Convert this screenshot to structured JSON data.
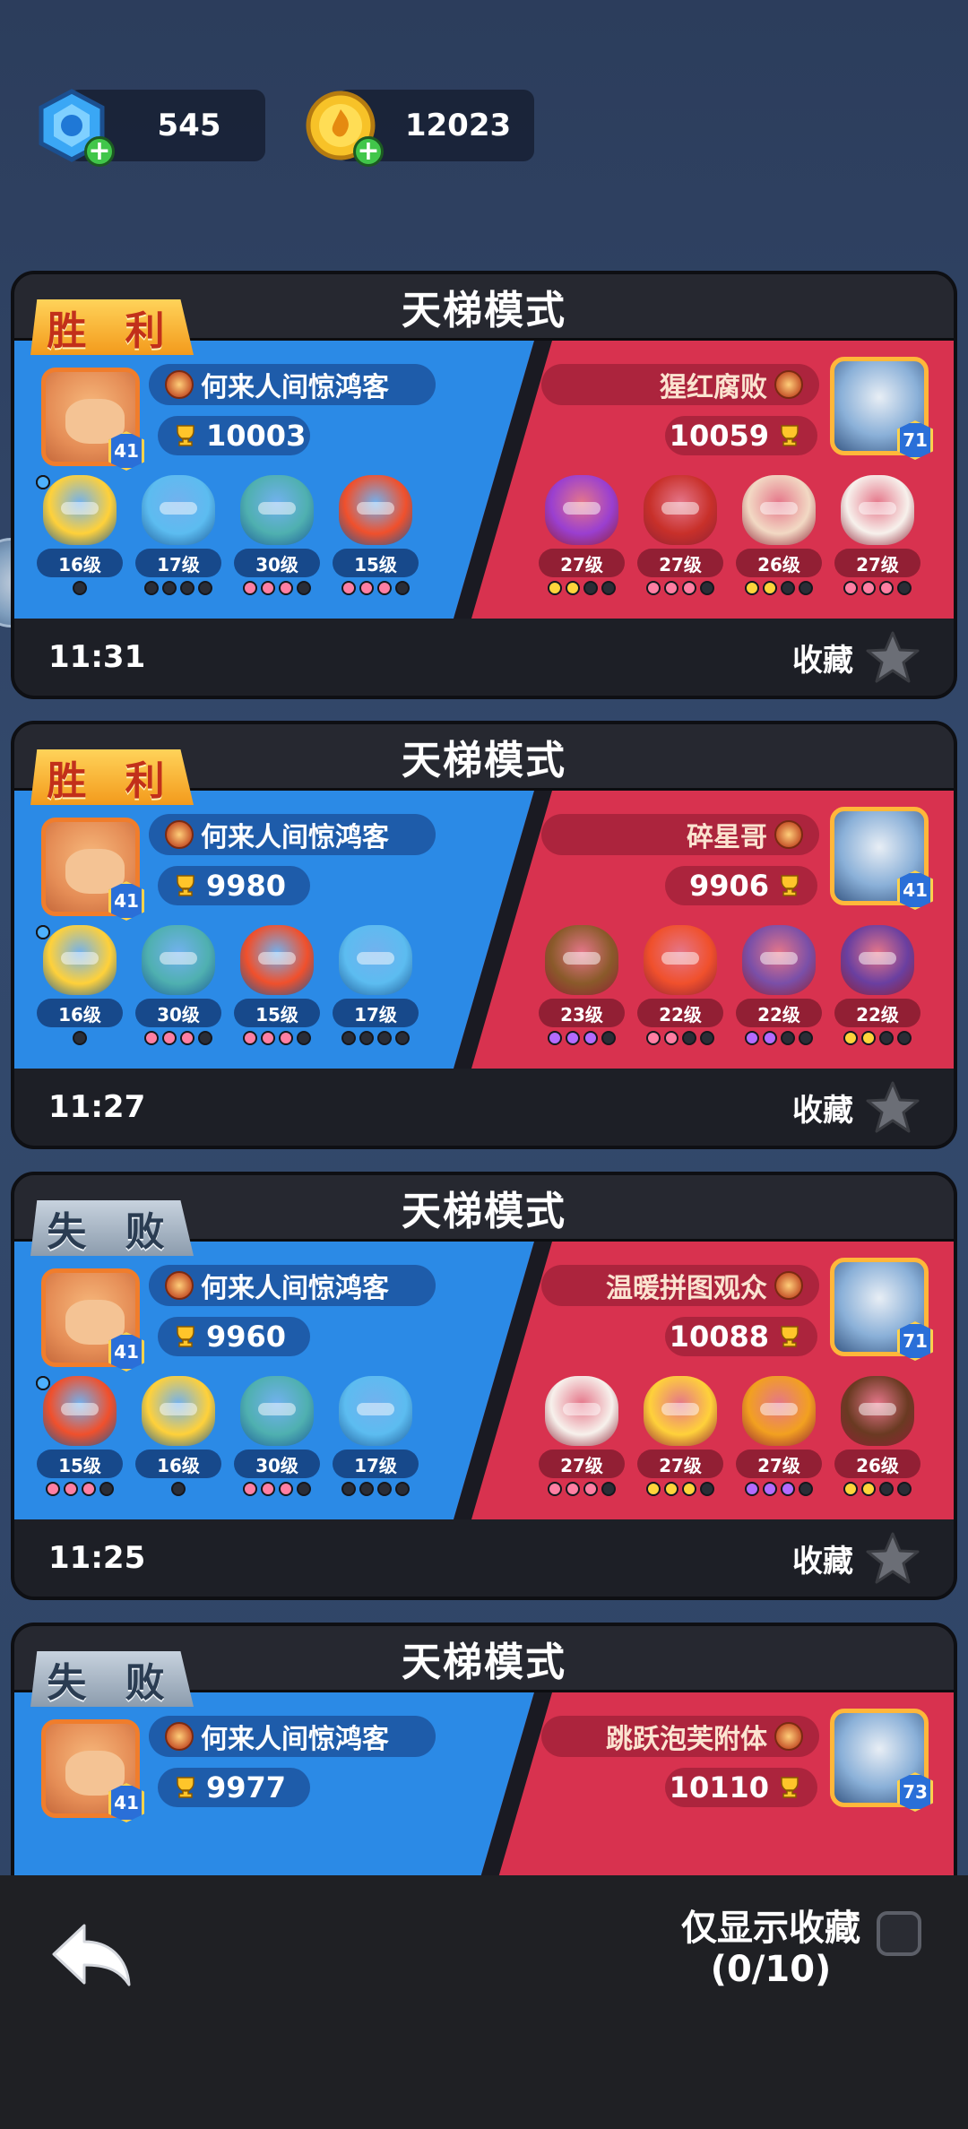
{
  "currency": {
    "gems": "545",
    "coins": "12023"
  },
  "cards": [
    {
      "mode": "天梯模式",
      "result": "胜 利",
      "result_type": "win",
      "time": "11:31",
      "fav_label": "收藏",
      "left_player": {
        "name": "何来人间惊鸿客",
        "trophies": "10003",
        "level": "41"
      },
      "right_player": {
        "name": "猩红腐败",
        "trophies": "10059",
        "level": "71"
      },
      "left_units": [
        {
          "lv": "16级",
          "dots": [
            "blue",
            "blue",
            "blue",
            "dark"
          ],
          "color": "#ffd13a"
        },
        {
          "lv": "17级",
          "dots": [
            "dark",
            "dark",
            "dark",
            "dark"
          ],
          "color": "#5cbcf0"
        },
        {
          "lv": "30级",
          "dots": [
            "pink",
            "pink",
            "pink",
            "dark"
          ],
          "color": "#4fb0b0"
        },
        {
          "lv": "15级",
          "dots": [
            "pink",
            "pink",
            "pink",
            "dark"
          ],
          "color": "#f0502c"
        }
      ],
      "right_units": [
        {
          "lv": "27级",
          "dots": [
            "yellow",
            "yellow",
            "dark",
            "dark"
          ],
          "color": "#9a3fd0"
        },
        {
          "lv": "27级",
          "dots": [
            "pink",
            "pink",
            "pink",
            "dark"
          ],
          "color": "#c8302a"
        },
        {
          "lv": "26级",
          "dots": [
            "yellow",
            "yellow",
            "dark",
            "dark"
          ],
          "color": "#f2d9c4"
        },
        {
          "lv": "27级",
          "dots": [
            "pink",
            "pink",
            "pink",
            "dark"
          ],
          "color": "#f7f1ec"
        }
      ]
    },
    {
      "mode": "天梯模式",
      "result": "胜 利",
      "result_type": "win",
      "time": "11:27",
      "fav_label": "收藏",
      "left_player": {
        "name": "何来人间惊鸿客",
        "trophies": "9980",
        "level": "41"
      },
      "right_player": {
        "name": "碎星哥",
        "trophies": "9906",
        "level": "41"
      },
      "left_units": [
        {
          "lv": "16级",
          "dots": [
            "blue",
            "blue",
            "blue",
            "dark"
          ],
          "color": "#ffd13a"
        },
        {
          "lv": "30级",
          "dots": [
            "pink",
            "pink",
            "pink",
            "dark"
          ],
          "color": "#4fb0b0"
        },
        {
          "lv": "15级",
          "dots": [
            "pink",
            "pink",
            "pink",
            "dark"
          ],
          "color": "#f0502c"
        },
        {
          "lv": "17级",
          "dots": [
            "dark",
            "dark",
            "dark",
            "dark"
          ],
          "color": "#5cbcf0"
        }
      ],
      "right_units": [
        {
          "lv": "23级",
          "dots": [
            "purple",
            "purple",
            "purple",
            "dark"
          ],
          "color": "#8a5a2a"
        },
        {
          "lv": "22级",
          "dots": [
            "pink",
            "pink",
            "dark",
            "dark"
          ],
          "color": "#f0502c"
        },
        {
          "lv": "22级",
          "dots": [
            "purple",
            "purple",
            "dark",
            "dark"
          ],
          "color": "#7a4fa8"
        },
        {
          "lv": "22级",
          "dots": [
            "yellow",
            "yellow",
            "dark",
            "dark"
          ],
          "color": "#6a3fa0"
        }
      ]
    },
    {
      "mode": "天梯模式",
      "result": "失 败",
      "result_type": "lose",
      "time": "11:25",
      "fav_label": "收藏",
      "left_player": {
        "name": "何来人间惊鸿客",
        "trophies": "9960",
        "level": "41"
      },
      "right_player": {
        "name": "温暖拼图观众",
        "trophies": "10088",
        "level": "71"
      },
      "left_units": [
        {
          "lv": "15级",
          "dots": [
            "pink",
            "pink",
            "pink",
            "dark"
          ],
          "color": "#f0502c"
        },
        {
          "lv": "16级",
          "dots": [
            "blue",
            "blue",
            "blue",
            "dark"
          ],
          "color": "#ffd13a"
        },
        {
          "lv": "30级",
          "dots": [
            "pink",
            "pink",
            "pink",
            "dark"
          ],
          "color": "#4fb0b0"
        },
        {
          "lv": "17级",
          "dots": [
            "dark",
            "dark",
            "dark",
            "dark"
          ],
          "color": "#5cbcf0"
        }
      ],
      "right_units": [
        {
          "lv": "27级",
          "dots": [
            "pink",
            "pink",
            "pink",
            "dark"
          ],
          "color": "#f7f1ec"
        },
        {
          "lv": "27级",
          "dots": [
            "yellow",
            "yellow",
            "yellow",
            "dark"
          ],
          "color": "#ffd13a"
        },
        {
          "lv": "27级",
          "dots": [
            "purple",
            "purple",
            "purple",
            "dark"
          ],
          "color": "#f2a020"
        },
        {
          "lv": "26级",
          "dots": [
            "yellow",
            "yellow",
            "dark",
            "dark"
          ],
          "color": "#6a3a22"
        }
      ]
    },
    {
      "mode": "天梯模式",
      "result": "失 败",
      "result_type": "lose",
      "time": "",
      "fav_label": "",
      "left_player": {
        "name": "何来人间惊鸿客",
        "trophies": "9977",
        "level": "41"
      },
      "right_player": {
        "name": "跳跃泡芙附体",
        "trophies": "10110",
        "level": "73"
      },
      "left_units": [],
      "right_units": []
    }
  ],
  "bottom": {
    "fav_only_line1": "仅显示收藏",
    "fav_only_line2": "(0/10)"
  },
  "colors": {
    "blue_side": "#2b8ae6",
    "red_side": "#d8324f",
    "win_banner": "#f39a1c",
    "lose_banner": "#8c9cad"
  }
}
